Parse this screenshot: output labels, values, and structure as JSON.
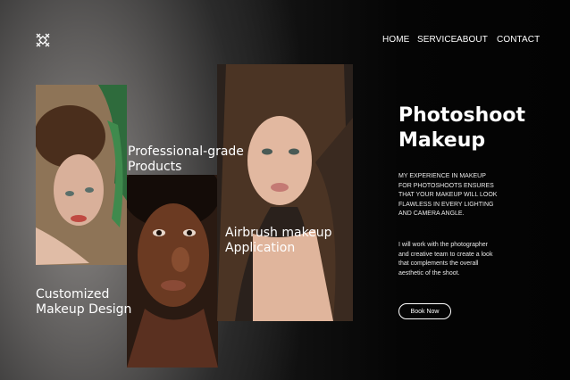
{
  "nav": {
    "home": "HOME",
    "service": "SERVICE",
    "about": "ABOUT",
    "contact": "CONTACT"
  },
  "hero": {
    "title_line1": "Photoshoot",
    "title_line2": "Makeup",
    "paragraph1": "MY EXPERIENCE IN MAKEUP FOR PHOTOSHOOTS ENSURES THAT YOUR MAKEUP WILL LOOK FLAWLESS IN EVERY LIGHTING AND CAMERA ANGLE.",
    "paragraph2": "I will work with the photographer and creative team to create a look that complements the overall aesthetic of the shoot.",
    "button": "Book Now"
  },
  "services": [
    {
      "line1": "Professional-grade",
      "line2": "Products"
    },
    {
      "line1": "Airbrush makeup",
      "line2": "Application"
    },
    {
      "line1": "Customized",
      "line2": "Makeup Design"
    }
  ],
  "colors": {
    "background": "#050505",
    "text": "#ffffff"
  }
}
